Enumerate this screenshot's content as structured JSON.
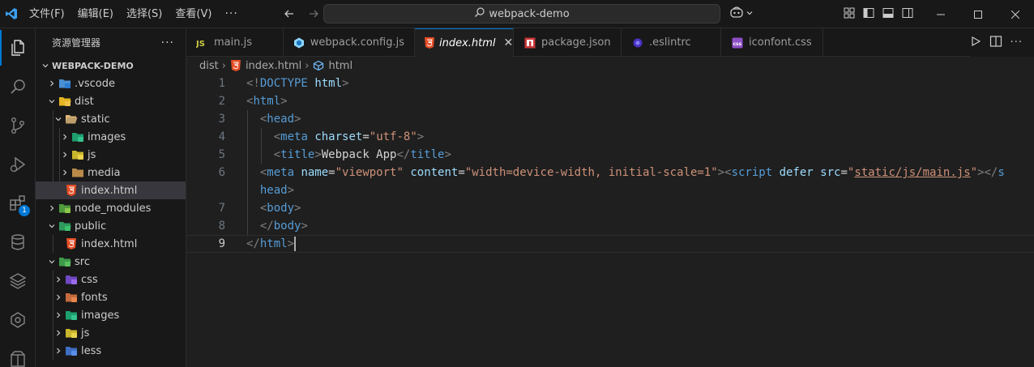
{
  "menu": [
    "文件(F)",
    "编辑(E)",
    "选择(S)",
    "查看(V)",
    "···"
  ],
  "search": {
    "text": "webpack-demo"
  },
  "explorer": {
    "title": "资源管理器",
    "more": "···",
    "tree": [
      {
        "label": "WEBPACK-DEMO",
        "depth": 0,
        "chevron": "down",
        "icon": "none",
        "root": true
      },
      {
        "label": ".vscode",
        "depth": 1,
        "chevron": "right",
        "icon": "folder-vscode-icon"
      },
      {
        "label": "dist",
        "depth": 1,
        "chevron": "down",
        "icon": "folder-dist-icon"
      },
      {
        "label": "static",
        "depth": 2,
        "chevron": "down",
        "icon": "folder-open-icon"
      },
      {
        "label": "images",
        "depth": 3,
        "chevron": "right",
        "icon": "folder-images-icon"
      },
      {
        "label": "js",
        "depth": 3,
        "chevron": "right",
        "icon": "folder-js-icon"
      },
      {
        "label": "media",
        "depth": 3,
        "chevron": "right",
        "icon": "folder-media-icon"
      },
      {
        "label": "index.html",
        "depth": 2,
        "chevron": "none",
        "icon": "html-file-icon",
        "selected": true
      },
      {
        "label": "node_modules",
        "depth": 1,
        "chevron": "right",
        "icon": "folder-node-icon"
      },
      {
        "label": "public",
        "depth": 1,
        "chevron": "down",
        "icon": "folder-public-icon"
      },
      {
        "label": "index.html",
        "depth": 2,
        "chevron": "none",
        "icon": "html-file-icon"
      },
      {
        "label": "src",
        "depth": 1,
        "chevron": "down",
        "icon": "folder-src-icon"
      },
      {
        "label": "css",
        "depth": 2,
        "chevron": "right",
        "icon": "folder-css-icon"
      },
      {
        "label": "fonts",
        "depth": 2,
        "chevron": "right",
        "icon": "folder-fonts-icon"
      },
      {
        "label": "images",
        "depth": 2,
        "chevron": "right",
        "icon": "folder-images-icon"
      },
      {
        "label": "js",
        "depth": 2,
        "chevron": "right",
        "icon": "folder-js-icon"
      },
      {
        "label": "less",
        "depth": 2,
        "chevron": "right",
        "icon": "folder-less-icon"
      }
    ]
  },
  "activity": {
    "extensions_badge": "1"
  },
  "tabs": [
    {
      "label": "main.js",
      "icon": "js-file-icon",
      "active": false
    },
    {
      "label": "webpack.config.js",
      "icon": "webpack-file-icon",
      "active": false
    },
    {
      "label": "index.html",
      "icon": "html-file-icon",
      "active": true,
      "close": "✕"
    },
    {
      "label": "package.json",
      "icon": "npm-file-icon",
      "active": false
    },
    {
      "label": ".eslintrc",
      "icon": "eslint-file-icon",
      "active": false
    },
    {
      "label": "iconfont.css",
      "icon": "css-file-icon",
      "active": false
    }
  ],
  "breadcrumb": {
    "folder": "dist",
    "file": "index.html",
    "symbol": "html"
  },
  "editor": {
    "current_line": "9",
    "lines": [
      {
        "n": "1",
        "tokens": [
          [
            "br",
            "<!"
          ],
          [
            "kw",
            "DOCTYPE"
          ],
          [
            "txt",
            " "
          ],
          [
            "attr",
            "html"
          ],
          [
            "br",
            ">"
          ]
        ],
        "indent": 0
      },
      {
        "n": "2",
        "tokens": [
          [
            "br",
            "<"
          ],
          [
            "tag",
            "html"
          ],
          [
            "br",
            ">"
          ]
        ],
        "indent": 0
      },
      {
        "n": "3",
        "tokens": [
          [
            "br",
            "<"
          ],
          [
            "tag",
            "head"
          ],
          [
            "br",
            ">"
          ]
        ],
        "indent": 1
      },
      {
        "n": "4",
        "tokens": [
          [
            "br",
            "<"
          ],
          [
            "tag",
            "meta"
          ],
          [
            "txt",
            " "
          ],
          [
            "attr",
            "charset"
          ],
          [
            "txt",
            "="
          ],
          [
            "str",
            "\"utf-8\""
          ],
          [
            "br",
            ">"
          ]
        ],
        "indent": 2
      },
      {
        "n": "5",
        "tokens": [
          [
            "br",
            "<"
          ],
          [
            "tag",
            "title"
          ],
          [
            "br",
            ">"
          ],
          [
            "txt",
            "Webpack App"
          ],
          [
            "br",
            "</"
          ],
          [
            "tag",
            "title"
          ],
          [
            "br",
            ">"
          ]
        ],
        "indent": 2
      },
      {
        "n": "6",
        "tokens": [
          [
            "br",
            "<"
          ],
          [
            "tag",
            "meta"
          ],
          [
            "txt",
            " "
          ],
          [
            "attr",
            "name"
          ],
          [
            "txt",
            "="
          ],
          [
            "str",
            "\"viewport\""
          ],
          [
            "txt",
            " "
          ],
          [
            "attr",
            "content"
          ],
          [
            "txt",
            "="
          ],
          [
            "str",
            "\"width=device-width, initial-scale=1\""
          ],
          [
            "br",
            ">"
          ],
          [
            "br",
            "<"
          ],
          [
            "tag",
            "script"
          ],
          [
            "txt",
            " "
          ],
          [
            "attr",
            "defer"
          ],
          [
            "txt",
            " "
          ],
          [
            "attr",
            "src"
          ],
          [
            "txt",
            "="
          ],
          [
            "str",
            "\""
          ],
          [
            "link",
            "static/js/main.js"
          ],
          [
            "str",
            "\""
          ],
          [
            "br",
            "></"
          ],
          [
            "tag",
            "s"
          ]
        ],
        "indent": 1
      },
      {
        "n": "",
        "tokens": [
          [
            "tag",
            "head"
          ],
          [
            "br",
            ">"
          ]
        ],
        "indent": 1
      },
      {
        "n": "7",
        "tokens": [
          [
            "br",
            "<"
          ],
          [
            "tag",
            "body"
          ],
          [
            "br",
            ">"
          ]
        ],
        "indent": 1
      },
      {
        "n": "8",
        "tokens": [
          [
            "br",
            "</"
          ],
          [
            "tag",
            "body"
          ],
          [
            "br",
            ">"
          ]
        ],
        "indent": 1
      },
      {
        "n": "9",
        "tokens": [
          [
            "br",
            "</"
          ],
          [
            "tag",
            "html"
          ],
          [
            "br",
            ">"
          ],
          [
            "cursor",
            ""
          ]
        ],
        "indent": 0
      }
    ]
  },
  "colors": {
    "accent": "#0078d4",
    "background": "#1f1f1f",
    "sidebar": "#181818"
  }
}
